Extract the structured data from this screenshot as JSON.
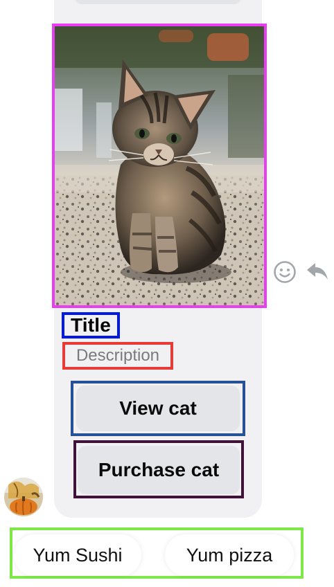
{
  "message": {
    "image": {
      "subject": "cat-photo-icon"
    },
    "title": "Title",
    "description": "Description",
    "buttons": [
      {
        "label": "View cat"
      },
      {
        "label": "Purchase cat"
      }
    ]
  },
  "actions": {
    "react_icon": "smiley-icon",
    "reply_icon": "reply-arrow-icon"
  },
  "quick_replies": [
    {
      "label": "Yum Sushi"
    },
    {
      "label": "Yum pizza"
    }
  ],
  "colors": {
    "card_bg": "#f1f1f3",
    "button_bg": "#e4e5e9",
    "image_outline": "#e83df0",
    "title_outline": "#0019e8",
    "description_outline": "#e63b36",
    "view_outline": "#265098",
    "purchase_outline": "#3f1338",
    "quick_reply_outline": "#7ee84a"
  }
}
